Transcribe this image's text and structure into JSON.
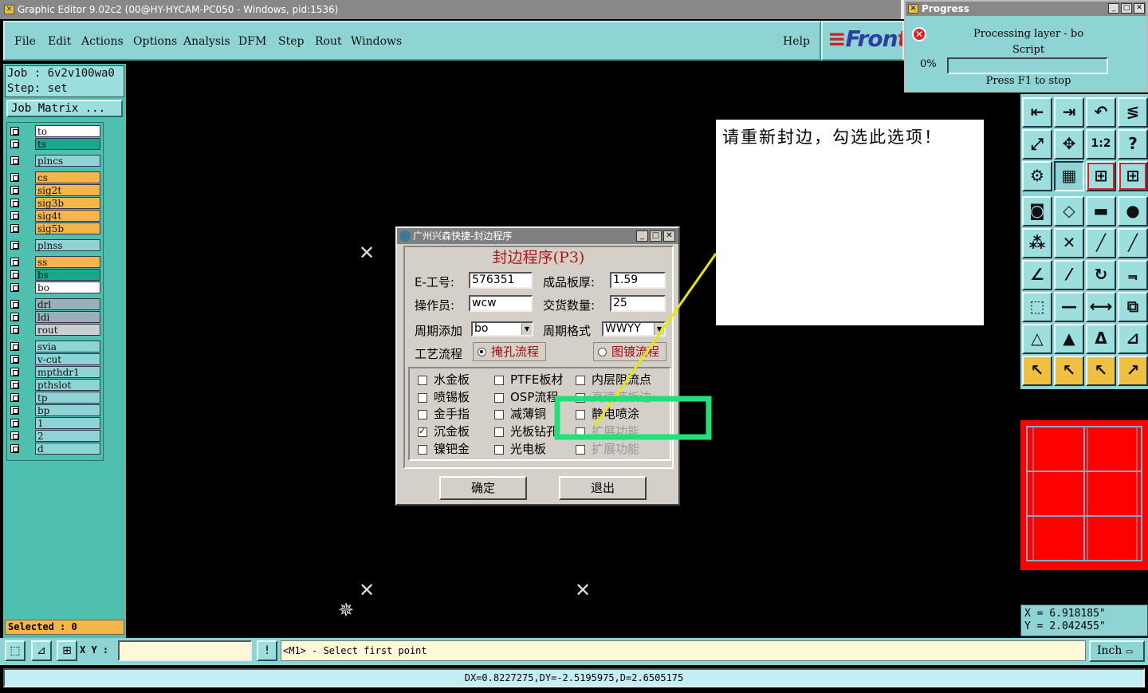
{
  "window": {
    "title": "Graphic Editor 9.02c2 (00@HY-HYCAM-PC050 - Windows, pid:1536)"
  },
  "menu": {
    "file": "File",
    "edit": "Edit",
    "actions": "Actions",
    "options": "Options",
    "analysis": "Analysis",
    "dfm": "DFM",
    "step": "Step",
    "rout": "Rout",
    "windows": "Windows",
    "help": "Help"
  },
  "logo": {
    "text_a": "Fron",
    "text_b": "t"
  },
  "job": {
    "line1": "Job : 6v2v100wa0",
    "line2": "Step: set",
    "matrix_button": "Job Matrix ..."
  },
  "layers": [
    {
      "name": "to",
      "color": "#ffffff"
    },
    {
      "name": "ts",
      "color": "#1aa88a"
    },
    {
      "name": "plncs",
      "color": "#8ed4d4"
    },
    {
      "name": "cs",
      "color": "#f4b648"
    },
    {
      "name": "sig2t",
      "color": "#f4b648"
    },
    {
      "name": "sig3b",
      "color": "#f4b648"
    },
    {
      "name": "sig4t",
      "color": "#f4b648"
    },
    {
      "name": "sig5b",
      "color": "#f4b648"
    },
    {
      "name": "plnss",
      "color": "#8ed4d4"
    },
    {
      "name": "ss",
      "color": "#f4b648"
    },
    {
      "name": "bs",
      "color": "#1aa88a"
    },
    {
      "name": "bo",
      "color": "#ffffff"
    },
    {
      "name": "drl",
      "color": "#9ab0b8"
    },
    {
      "name": "ldi",
      "color": "#9ab0b8"
    },
    {
      "name": "rout",
      "color": "#c8d0d0"
    },
    {
      "name": "svia",
      "color": "#8ed4d4"
    },
    {
      "name": "v-cut",
      "color": "#8ed4d4"
    },
    {
      "name": "mpthdr1",
      "color": "#8ed4d4"
    },
    {
      "name": "pthslot",
      "color": "#8ed4d4"
    },
    {
      "name": "tp",
      "color": "#8ed4d4"
    },
    {
      "name": "bp",
      "color": "#8ed4d4"
    },
    {
      "name": "1",
      "color": "#8ed4d4"
    },
    {
      "name": "2",
      "color": "#8ed4d4"
    },
    {
      "name": "d",
      "color": "#8ed4d4"
    }
  ],
  "selected": "Selected : 0",
  "progress": {
    "title": "Progress",
    "line1": "Processing layer - bo",
    "line2": "Script",
    "percent": "0%",
    "value": 0,
    "stop_hint": "Press F1 to stop"
  },
  "note": "请重新封边，勾选此选项！",
  "dialog": {
    "title": "广州兴森快捷-封边程序",
    "heading": "封边程序(P3)",
    "e_job_label": "E-工号:",
    "e_job_value": "576351",
    "thickness_label": "成品板厚:",
    "thickness_value": "1.59",
    "operator_label": "操作员:",
    "operator_value": "wcw",
    "qty_label": "交货数量:",
    "qty_value": "25",
    "period_add_label": "周期添加",
    "period_add_value": "bo",
    "period_format_label": "周期格式",
    "period_format_value": "WWYY",
    "process_label": "工艺流程",
    "process_opt1": "掩孔流程",
    "process_opt2": "图镀流程",
    "options": [
      {
        "label": "水金板",
        "checked": false,
        "enabled": true
      },
      {
        "label": "喷锡板",
        "checked": false,
        "enabled": true
      },
      {
        "label": "金手指",
        "checked": false,
        "enabled": true
      },
      {
        "label": "沉金板",
        "checked": true,
        "enabled": true
      },
      {
        "label": "镍钯金",
        "checked": false,
        "enabled": true
      },
      {
        "label": "PTFE板材",
        "checked": false,
        "enabled": true
      },
      {
        "label": "OSP流程",
        "checked": false,
        "enabled": true
      },
      {
        "label": "减薄铜",
        "checked": false,
        "enabled": true
      },
      {
        "label": "光板钻孔",
        "checked": false,
        "enabled": true
      },
      {
        "label": "光电板",
        "checked": false,
        "enabled": true
      },
      {
        "label": "内层阻流点",
        "checked": false,
        "enabled": true
      },
      {
        "label": "高速液板边",
        "checked": false,
        "enabled": false
      },
      {
        "label": "静电喷涂",
        "checked": false,
        "enabled": true
      },
      {
        "label": "扩展功能",
        "checked": false,
        "enabled": false
      },
      {
        "label": "扩展功能",
        "checked": false,
        "enabled": false
      }
    ],
    "ok": "确定",
    "exit": "退出"
  },
  "coords": {
    "x": "X = 6.918185\"",
    "y": "Y = 2.042455\""
  },
  "xy_label": "X Y :",
  "xy_value": "",
  "prompt": "<M1> - Select first point",
  "units": "Inch",
  "status": "DX=0.8227275,DY=-2.5195975,D=2.6505175"
}
